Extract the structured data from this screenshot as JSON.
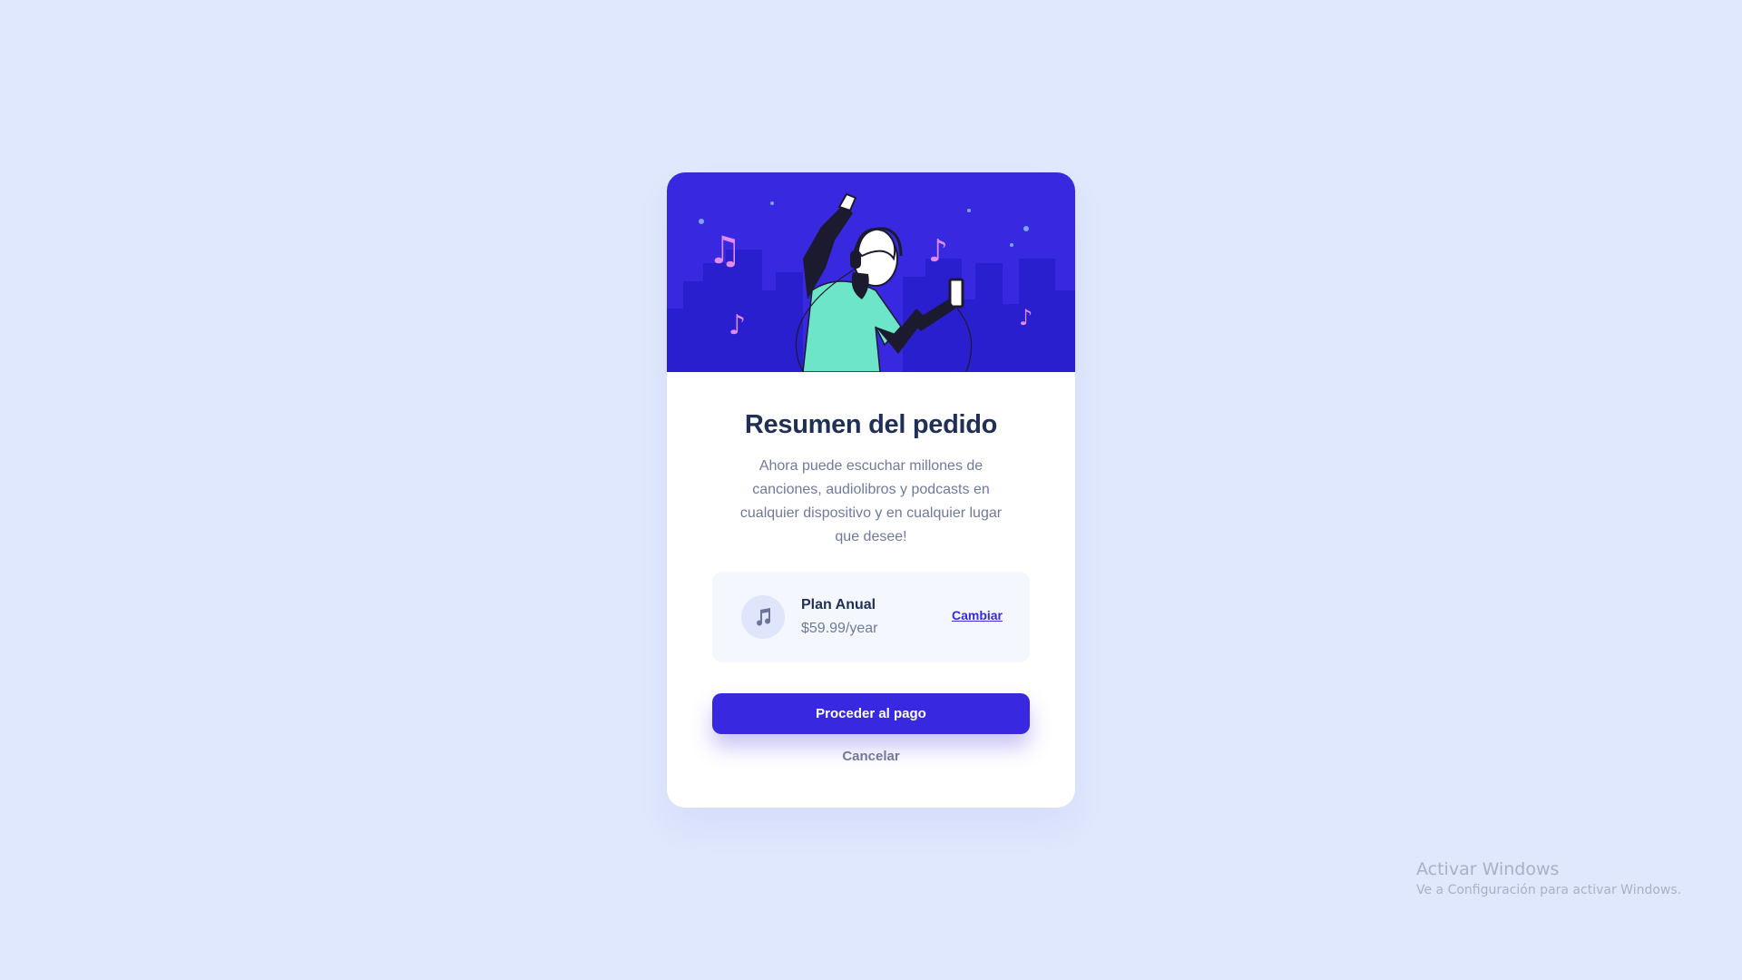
{
  "card": {
    "title": "Resumen del pedido",
    "description": "Ahora puede escuchar millones de canciones, audiolibros y podcasts en cualquier dispositivo y en cualquier lugar que desee!",
    "plan": {
      "icon": "music-note-icon",
      "name": "Plan Anual",
      "price": "$59.99/year",
      "change_label": "Cambiar"
    },
    "pay_label": "Proceder al pago",
    "cancel_label": "Cancelar"
  },
  "watermark": {
    "title": "Activar Windows",
    "subtitle": "Ve a Configuración para activar Windows."
  },
  "colors": {
    "background": "#e0e8fd",
    "accent": "#3829e0",
    "heading": "#1f2f56",
    "muted_text": "#707a9c",
    "plan_bg": "#f5f7ff",
    "illustration_shirt": "#6de5c8",
    "illustration_notes": "#e28bef"
  }
}
